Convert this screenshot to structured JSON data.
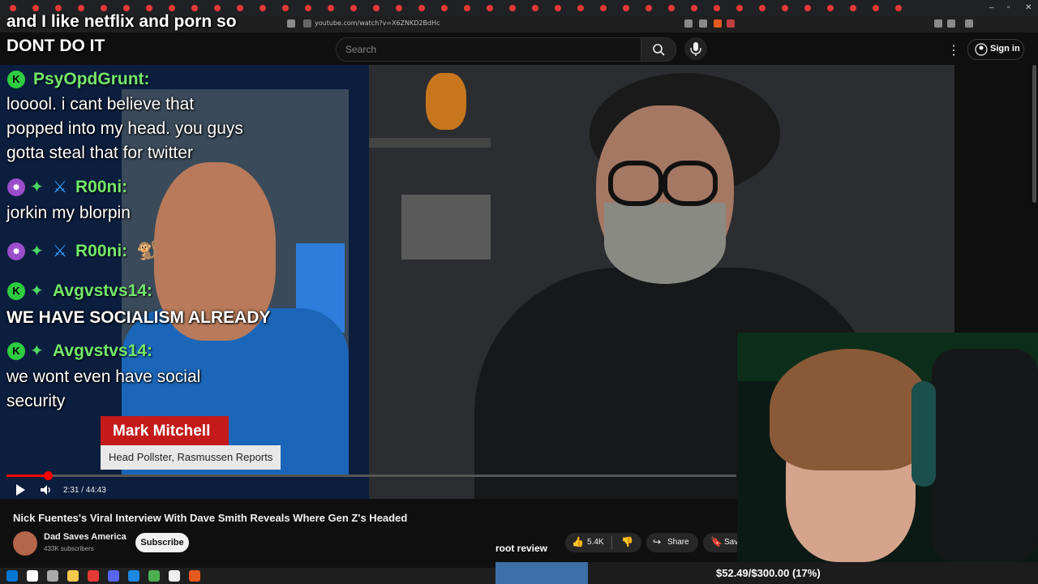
{
  "browser": {
    "url": "youtube.com/watch?v=X6ZNKD2BdHc"
  },
  "youtube": {
    "search_placeholder": "Search",
    "sign_in": "Sign in"
  },
  "overlay": {
    "top_line1": "and I like netflix and porn so",
    "top_line2": "DONT DO IT"
  },
  "chat": [
    {
      "user": "PsyOpdGrunt:",
      "lines": [
        "looool. i cant believe that",
        "popped into my head. you guys",
        "gotta steal that for twitter"
      ]
    },
    {
      "user": "R00ni:",
      "lines": [
        "jorkin my blorpin"
      ]
    },
    {
      "user": "R00ni:",
      "lines": []
    },
    {
      "user": "Avgvstvs14:",
      "lines": [
        "WE HAVE SOCIALISM ALREADY"
      ]
    },
    {
      "user": "Avgvstvs14:",
      "lines": [
        "we wont even have social",
        "security"
      ]
    }
  ],
  "lower_third": {
    "name": "Mark Mitchell",
    "title": "Head Pollster, Rasmussen Reports"
  },
  "player": {
    "time": "2:31 / 44:43",
    "progress": 0.0564
  },
  "video": {
    "title": "Nick Fuentes's Viral Interview With Dave Smith Reveals Where Gen Z's Headed",
    "channel": "Dad Saves America",
    "subscribers": "433K subscribers",
    "subscribe_label": "Subscribe",
    "likes": "5.4K",
    "share_label": "Share",
    "save_label": "Sav"
  },
  "stream": {
    "label": "root review",
    "donation_text": "$52.49/$300.00 (17%)",
    "donation_fraction": 0.17
  },
  "colors": {
    "progress": "#ff0000",
    "chat_name": "#74e86a",
    "nameplate": "#c41a1a",
    "donation_fill": "#3d6fa8"
  }
}
